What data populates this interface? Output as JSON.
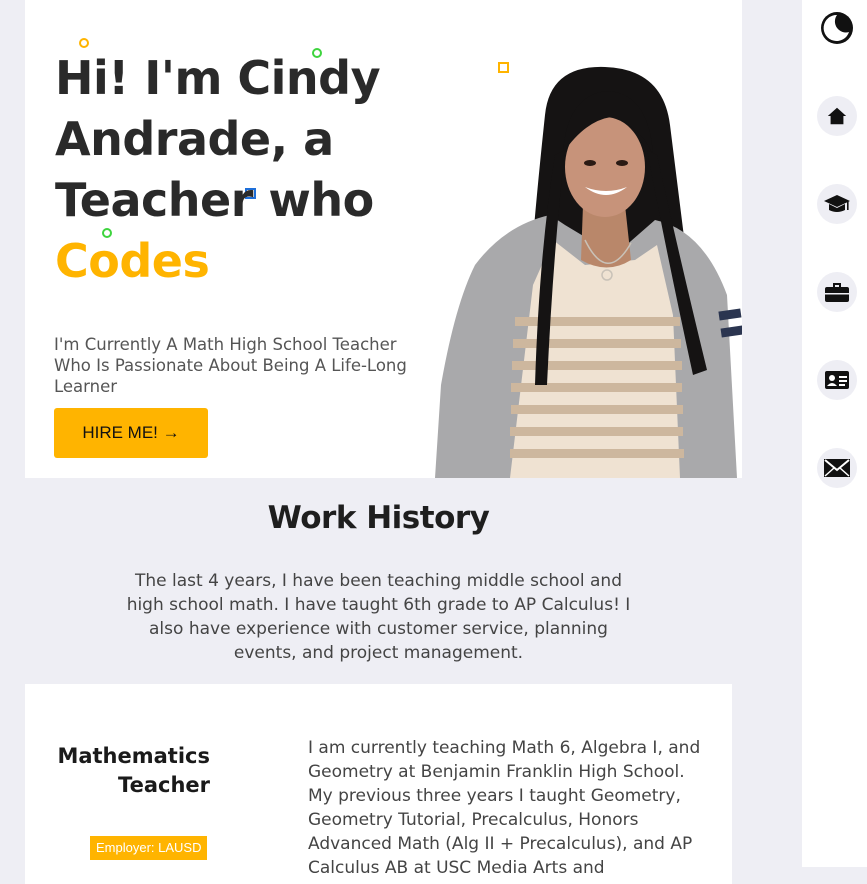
{
  "hero": {
    "title_line_1": "Hi! I'm Cindy",
    "title_line_2": "Andrade, a",
    "title_line_3": "Teacher who",
    "title_accent": "Codes",
    "subtitle": "I'm Currently A Math High School Teacher Who Is Passionate About Being A Life-Long Learner",
    "hire_button": "HIRE ME! →",
    "accent_color": "#ffb400"
  },
  "sidebar": {
    "items": [
      {
        "icon": "theme-toggle-icon"
      },
      {
        "icon": "home-icon"
      },
      {
        "icon": "graduation-cap-icon"
      },
      {
        "icon": "briefcase-icon"
      },
      {
        "icon": "contact-card-icon"
      },
      {
        "icon": "envelope-icon"
      }
    ]
  },
  "work_history": {
    "title": "Work History",
    "description": "The last 4 years, I have been teaching middle school and high school math. I have taught 6th grade to AP Calculus! I also have experience with customer service, planning events, and project management.",
    "jobs": [
      {
        "title": "Mathematics Teacher",
        "employer": "Employer: LAUSD",
        "description": "I am currently teaching Math 6, Algebra I, and Geometry at Benjamin Franklin High School. My previous three years I taught Geometry, Geometry Tutorial, Precalculus, Honors Advanced Math (Alg II + Precalculus), and AP Calculus AB at USC Media Arts and"
      }
    ]
  }
}
